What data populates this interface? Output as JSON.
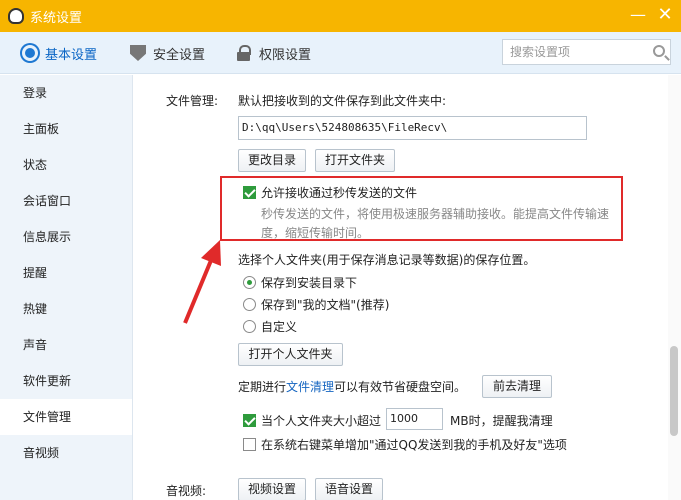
{
  "window": {
    "title": "系统设置"
  },
  "tabs": [
    {
      "label": "基本设置",
      "active": true
    },
    {
      "label": "安全设置",
      "active": false
    },
    {
      "label": "权限设置",
      "active": false
    }
  ],
  "search": {
    "placeholder": "搜索设置项"
  },
  "sidebar": {
    "items": [
      {
        "label": "登录"
      },
      {
        "label": "主面板"
      },
      {
        "label": "状态"
      },
      {
        "label": "会话窗口"
      },
      {
        "label": "信息展示"
      },
      {
        "label": "提醒"
      },
      {
        "label": "热键"
      },
      {
        "label": "声音"
      },
      {
        "label": "软件更新"
      },
      {
        "label": "文件管理",
        "active": true
      },
      {
        "label": "音视频"
      }
    ]
  },
  "file_mgmt": {
    "section_label": "文件管理:",
    "save_path_desc": "默认把接收到的文件保存到此文件夹中:",
    "save_path_value": "D:\\qq\\Users\\524808635\\FileRecv\\",
    "change_dir_button": "更改目录",
    "open_folder_button": "打开文件夹",
    "allow_flash_transfer": {
      "label": "允许接收通过秒传发送的文件",
      "checked": true,
      "desc_line1": "秒传发送的文件，将使用极速服务器辅助接收。能提高文件传输速",
      "desc_line2": "度，缩短传输时间。"
    },
    "personal_folder_desc": "选择个人文件夹(用于保存消息记录等数据)的保存位置。",
    "radio_options": [
      {
        "label": "保存到安装目录下",
        "checked": true
      },
      {
        "label": "保存到\"我的文档\"(推荐)",
        "checked": false
      },
      {
        "label": "自定义",
        "checked": false
      }
    ],
    "open_personal_folder_button": "打开个人文件夹",
    "cleanup_text_prefix": "定期进行",
    "cleanup_link": "文件清理",
    "cleanup_text_suffix": "可以有效节省硬盘空间。",
    "go_cleanup_button": "前去清理",
    "size_remind": {
      "prefix": "当个人文件夹大小超过",
      "value": "1000",
      "suffix": "MB时，提醒我清理",
      "checked": true
    },
    "context_menu": {
      "label": "在系统右键菜单增加\"通过QQ发送到我的手机及好友\"选项",
      "checked": false
    }
  },
  "av": {
    "section_label": "音视频:",
    "video_button": "视频设置",
    "audio_button": "语音设置"
  },
  "colors": {
    "titlebar": "#f7b500",
    "accent": "#0a65c5",
    "highlight_box": "#e02a2a",
    "check": "#2e9b3c"
  }
}
